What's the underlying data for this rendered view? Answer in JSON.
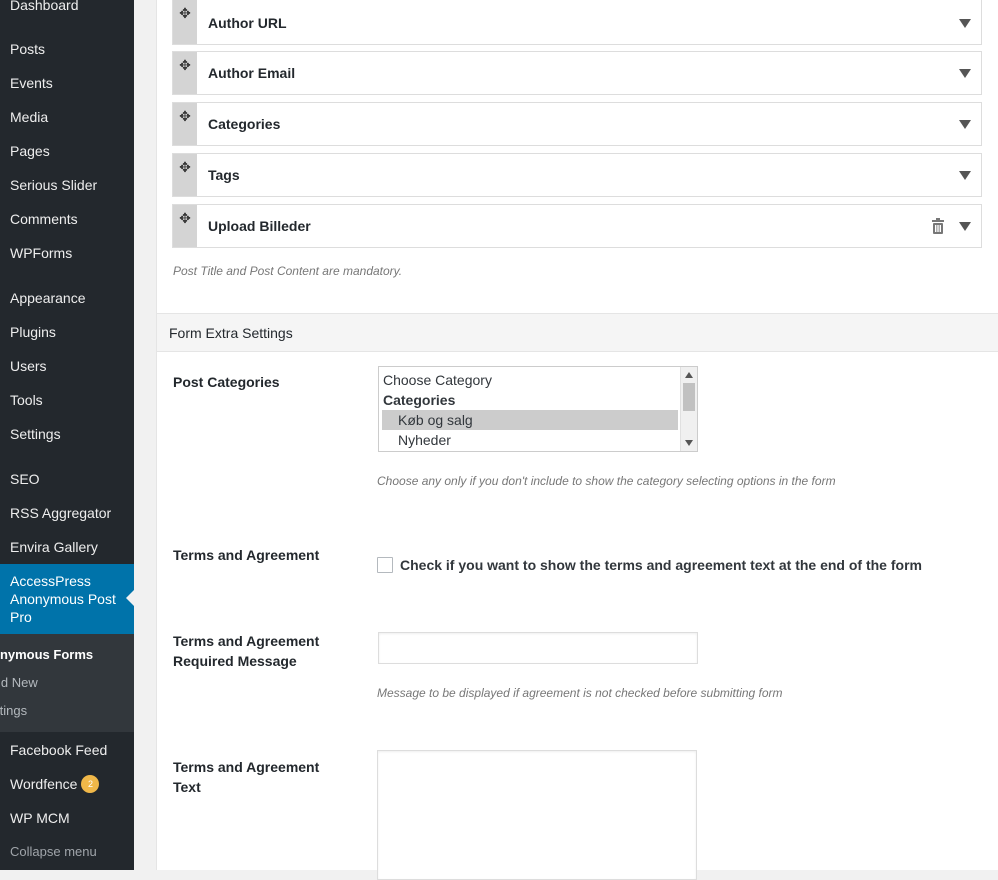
{
  "sidebar": {
    "items": [
      {
        "label": "Dashboard"
      },
      {
        "label": "Posts"
      },
      {
        "label": "Events"
      },
      {
        "label": "Media"
      },
      {
        "label": "Pages"
      },
      {
        "label": "Serious Slider"
      },
      {
        "label": "Comments"
      },
      {
        "label": "WPForms"
      },
      {
        "label": "Appearance"
      },
      {
        "label": "Plugins"
      },
      {
        "label": "Users"
      },
      {
        "label": "Tools"
      },
      {
        "label": "Settings"
      },
      {
        "label": "SEO"
      },
      {
        "label": "RSS Aggregator"
      },
      {
        "label": "Envira Gallery"
      },
      {
        "label": "AccessPress Anonymous Post Pro"
      },
      {
        "label": "Facebook Feed"
      },
      {
        "label": "Wordfence",
        "badge": "2"
      },
      {
        "label": "WP MCM"
      }
    ],
    "submenu": [
      {
        "label": "onymous Forms"
      },
      {
        "label": "ld New"
      },
      {
        "label": "ttings"
      }
    ],
    "collapse_label": "Collapse menu",
    "accent_color": "#0073aa"
  },
  "form_fields": [
    {
      "label": "Author URL"
    },
    {
      "label": "Author Email"
    },
    {
      "label": "Categories"
    },
    {
      "label": "Tags"
    },
    {
      "label": "Upload Billeder",
      "icon": "trash-icon"
    }
  ],
  "mandatory_note": "Post Title and Post Content are mandatory.",
  "extra_settings": {
    "title": "Form Extra Settings",
    "post_categories": {
      "label": "Post Categories",
      "options": [
        "Choose Category",
        "Categories",
        "Køb og salg",
        "Nyheder"
      ],
      "selected": "Køb og salg",
      "help": "Choose any only if you don't include to show the category selecting options in the form"
    },
    "terms": {
      "label": "Terms and Agreement",
      "checkbox_label": "Check if you want to show the terms and agreement text at the end of the form"
    },
    "terms_message": {
      "label": "Terms and Agreement Required Message",
      "value": "",
      "help": "Message to be displayed if agreement is not checked before submitting form"
    },
    "terms_text": {
      "label": "Terms and Agreement Text",
      "value": ""
    }
  }
}
